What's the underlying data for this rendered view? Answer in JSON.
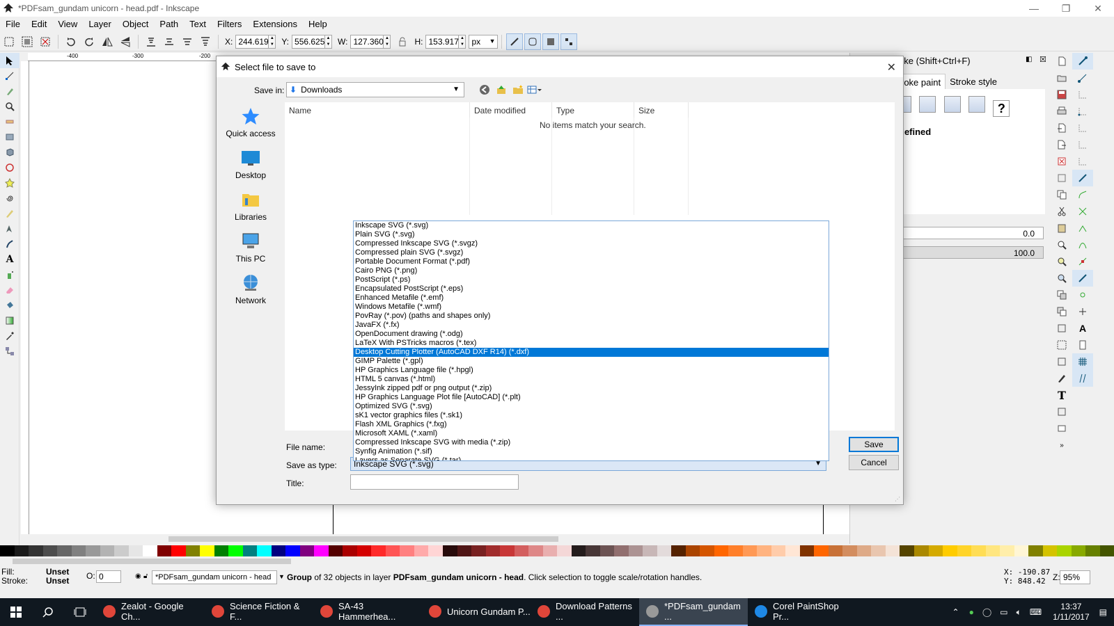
{
  "window": {
    "title": "*PDFsam_gundam unicorn - head.pdf - Inkscape",
    "controls": [
      "—",
      "❐",
      "✕"
    ]
  },
  "menu": [
    "File",
    "Edit",
    "View",
    "Layer",
    "Object",
    "Path",
    "Text",
    "Filters",
    "Extensions",
    "Help"
  ],
  "toolbar": {
    "x_label": "X:",
    "x_value": "244.619",
    "y_label": "Y:",
    "y_value": "556.625",
    "w_label": "W:",
    "w_value": "127.360",
    "h_label": "H:",
    "h_value": "153.917",
    "unit": "px"
  },
  "ruler": {
    "labels": [
      "-400",
      "-300",
      "-200"
    ]
  },
  "dock": {
    "title": "oke (Shift+Ctrl+F)",
    "tabs": [
      "roke paint",
      "Stroke style"
    ],
    "undefined_label": "defined",
    "blur_value": "0.0",
    "opacity_value": "100.0"
  },
  "dialog": {
    "title": "Select file to save to",
    "save_in_label": "Save in:",
    "save_in_value": "Downloads",
    "places": [
      "Quick access",
      "Desktop",
      "Libraries",
      "This PC",
      "Network"
    ],
    "columns": [
      "Name",
      "Date modified",
      "Type",
      "Size"
    ],
    "empty_message": "No items match your search.",
    "file_name_label": "File name:",
    "save_as_type_label": "Save as type:",
    "title_label": "Title:",
    "save_as_type_value": "Inkscape SVG (*.svg)",
    "save_button": "Save",
    "cancel_button": "Cancel",
    "selected_type_index": 14,
    "types": [
      "Inkscape SVG (*.svg)",
      "Plain SVG (*.svg)",
      "Compressed Inkscape SVG (*.svgz)",
      "Compressed plain SVG (*.svgz)",
      "Portable Document Format (*.pdf)",
      "Cairo PNG (*.png)",
      "PostScript (*.ps)",
      "Encapsulated PostScript (*.eps)",
      "Enhanced Metafile (*.emf)",
      "Windows Metafile (*.wmf)",
      "PovRay (*.pov) (paths and shapes only)",
      "JavaFX (*.fx)",
      "OpenDocument drawing (*.odg)",
      "LaTeX With PSTricks macros (*.tex)",
      "Desktop Cutting Plotter (AutoCAD DXF R14) (*.dxf)",
      "GIMP Palette (*.gpl)",
      "HP Graphics Language file (*.hpgl)",
      "HTML 5 canvas (*.html)",
      "JessyInk zipped pdf or png output (*.zip)",
      "HP Graphics Language Plot file [AutoCAD] (*.plt)",
      "Optimized SVG (*.svg)",
      "sK1 vector graphics files (*.sk1)",
      "Flash XML Graphics (*.fxg)",
      "Microsoft XAML (*.xaml)",
      "Compressed Inkscape SVG with media (*.zip)",
      "Synfig Animation (*.sif)",
      "Layers as Separate SVG (*.tar)"
    ]
  },
  "palette": [
    "#000000",
    "#1a1a1a",
    "#333333",
    "#4d4d4d",
    "#666666",
    "#808080",
    "#999999",
    "#b3b3b3",
    "#cccccc",
    "#e6e6e6",
    "#ffffff",
    "#800000",
    "#ff0000",
    "#808000",
    "#ffff00",
    "#008000",
    "#00ff00",
    "#008080",
    "#00ffff",
    "#000080",
    "#0000ff",
    "#800080",
    "#ff00ff",
    "#550000",
    "#aa0000",
    "#d40000",
    "#ff2a2a",
    "#ff5555",
    "#ff8080",
    "#ffaaaa",
    "#ffd5d5",
    "#280b0b",
    "#501616",
    "#782121",
    "#a02c2c",
    "#c83737",
    "#d35f5f",
    "#de8787",
    "#e9afaf",
    "#f4d7d7",
    "#241c1c",
    "#483737",
    "#6c5353",
    "#916f6f",
    "#ac9393",
    "#c8b7b7",
    "#e3dbdb",
    "#552200",
    "#aa4400",
    "#d45500",
    "#ff6600",
    "#ff7f2a",
    "#ff9955",
    "#ffb380",
    "#ffccaa",
    "#ffe6d5",
    "#803300",
    "#ff6600",
    "#c87137",
    "#d38d5f",
    "#deaa87",
    "#e9c6af",
    "#f4e3d7",
    "#554400",
    "#aa8800",
    "#d4aa00",
    "#ffcc00",
    "#ffd42a",
    "#ffdd55",
    "#ffe680",
    "#ffeeaa",
    "#fff6d5",
    "#808000",
    "#d4c300",
    "#aad400",
    "#88aa00",
    "#668000",
    "#445500"
  ],
  "status": {
    "fill_label": "Fill:",
    "stroke_label": "Stroke:",
    "fill_value": "Unset",
    "stroke_value": "Unset",
    "o_label": "O:",
    "o_value": "0",
    "layer": "*PDFsam_gundam unicorn - head",
    "message_pre": "Group",
    "message_mid1": " of 32 objects in layer ",
    "message_layer": "PDFsam_gundam unicorn - head",
    "message_post": ". Click selection to toggle scale/rotation handles.",
    "x_coord": "X: -190.87",
    "y_coord": "Y:  848.42",
    "zoom_label": "Z:",
    "zoom": "95%"
  },
  "taskbar": {
    "tasks": [
      {
        "label": "Zealot - Google Ch...",
        "color": "#e0463a"
      },
      {
        "label": "Science Fiction & F...",
        "color": "#e0463a"
      },
      {
        "label": "SA-43 Hammerhea...",
        "color": "#e0463a"
      },
      {
        "label": "Unicorn Gundam P...",
        "color": "#e0463a"
      },
      {
        "label": "Download Patterns ...",
        "color": "#e0463a"
      },
      {
        "label": "*PDFsam_gundam ...",
        "color": "#999999"
      },
      {
        "label": "Corel PaintShop Pr...",
        "color": "#1e88e5"
      }
    ],
    "time": "13:37",
    "date": "1/11/2017"
  }
}
